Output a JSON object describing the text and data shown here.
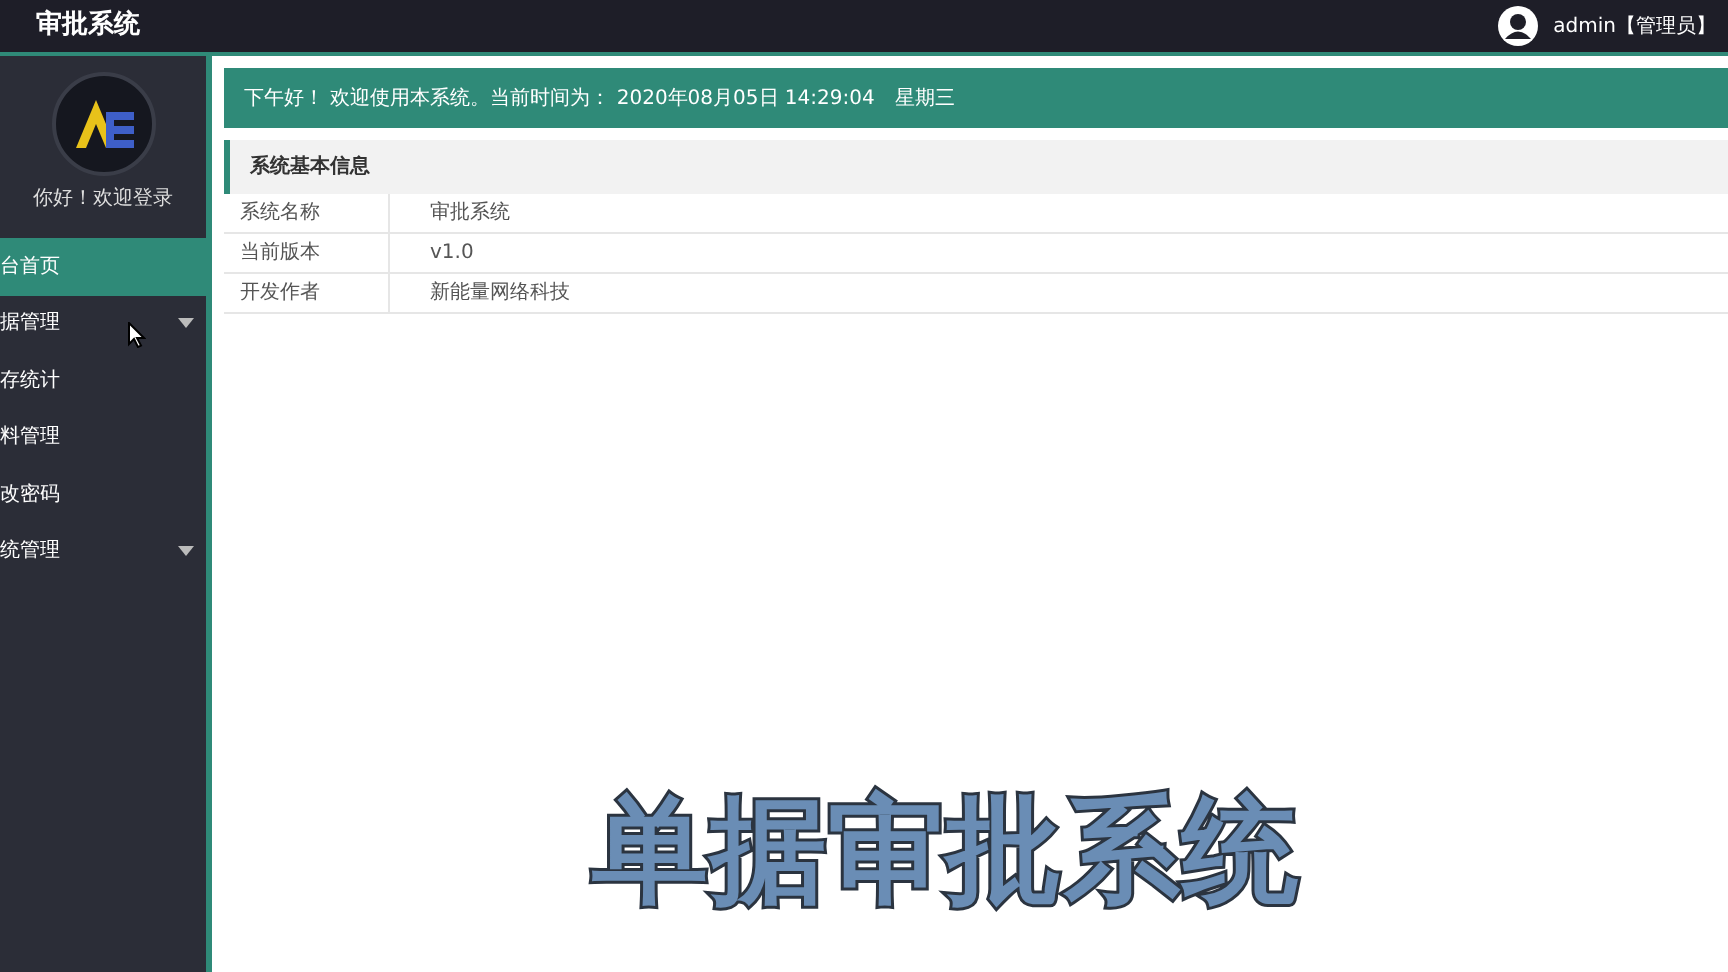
{
  "header": {
    "title": "审批系统",
    "user": "admin【管理员】"
  },
  "sidebar": {
    "greeting": "你好！欢迎登录",
    "items": [
      {
        "label": "台首页",
        "selected": true,
        "has_submenu": false
      },
      {
        "label": "据管理",
        "selected": false,
        "has_submenu": true
      },
      {
        "label": "存统计",
        "selected": false,
        "has_submenu": false
      },
      {
        "label": "料管理",
        "selected": false,
        "has_submenu": false
      },
      {
        "label": "改密码",
        "selected": false,
        "has_submenu": false
      },
      {
        "label": "统管理",
        "selected": false,
        "has_submenu": true
      }
    ]
  },
  "welcome_bar": "下午好！ 欢迎使用本系统。当前时间为： 2020年08月05日 14:29:04　星期三",
  "info_panel": {
    "title": "系统基本信息",
    "rows": [
      {
        "label": "系统名称",
        "value": "审批系统"
      },
      {
        "label": "当前版本",
        "value": "v1.0"
      },
      {
        "label": "开发作者",
        "value": "新能量网络科技"
      }
    ]
  },
  "caption": "单据审批系统"
}
